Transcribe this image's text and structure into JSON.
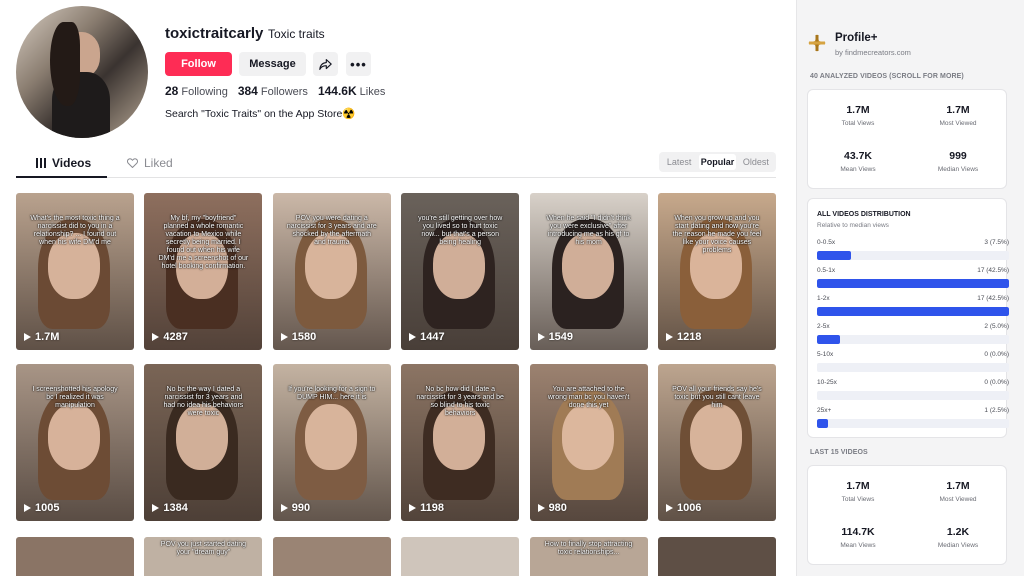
{
  "profile": {
    "username": "toxictraitcarly",
    "nickname": "Toxic traits",
    "follow_label": "Follow",
    "message_label": "Message",
    "following_count": "28",
    "following_label": "Following",
    "followers_count": "384",
    "followers_label": "Followers",
    "likes_count": "144.6K",
    "likes_label": "Likes",
    "bio": "Search \"Toxic Traits\" on the App Store☢️"
  },
  "tabs": {
    "videos": "Videos",
    "liked": "Liked"
  },
  "sort": {
    "latest": "Latest",
    "popular": "Popular",
    "oldest": "Oldest",
    "active": "Popular"
  },
  "videos": [
    {
      "views": "1.7M",
      "caption": "What's the most toxic thing a narcissist did to you in a relationship? ... I found out when his wife DM'd me",
      "bg": "#b9a28e",
      "hair": "#6b4a34"
    },
    {
      "views": "4287",
      "caption": "My bf, my \"boyfriend\" planned a whole romantic vacation to Mexico while secretly being married. I found out when his wife DM'd me a screenshot of our hotel booking confirmation.",
      "bg": "#8e6f5e",
      "hair": "#4a2f22"
    },
    {
      "views": "1580",
      "caption": "POV you were dating a narcissist for 3 years and are shocked by the aftermath and trauma",
      "bg": "#cbb8a8",
      "hair": "#7d5a3e"
    },
    {
      "views": "1447",
      "caption": "you're still getting over how you lived so to hurt toxic now... but that's a person being healing",
      "bg": "#6a625b",
      "hair": "#2e2320"
    },
    {
      "views": "1549",
      "caption": "When he said \"I didn't think you were exclusive\" after introducing me as his gf to his mom",
      "bg": "#d8d1c9",
      "hair": "#2b2220"
    },
    {
      "views": "1218",
      "caption": "When you grow up and you start dating and now you're the reason he made you feel like your voice causes problems",
      "bg": "#c7a98c",
      "hair": "#8a5f3a"
    },
    {
      "views": "1005",
      "caption": "I screenshotted his apology bc I realized it was manipulation",
      "bg": "#a89586",
      "hair": "#6d4c35"
    },
    {
      "views": "1384",
      "caption": "No bc the way I dated a narcissist for 3 years and had no idea his behaviors were toxic",
      "bg": "#7a6556",
      "hair": "#3a2a20"
    },
    {
      "views": "990",
      "caption": "If you're looking for a sign to DUMP HIM... here it is",
      "bg": "#c4b3a2",
      "hair": "#7e5c43"
    },
    {
      "views": "1198",
      "caption": "No bc how did I date a narcissist for 3 years and be so blind to his toxic behaviors",
      "bg": "#8c7564",
      "hair": "#3e2c22"
    },
    {
      "views": "980",
      "caption": "You are attached to the wrong man bc you haven't done this yet",
      "bg": "#9c8270",
      "hair": "#a07b55"
    },
    {
      "views": "1006",
      "caption": "POV all your friends say he's toxic but you still cant leave him",
      "bg": "#bda58f",
      "hair": "#6f4f36"
    }
  ],
  "videos_partial": [
    {
      "caption": "",
      "bg": "#8a7465"
    },
    {
      "caption": "POV you just started dating your \"dream guy\"",
      "bg": "#bfb1a3"
    },
    {
      "caption": "",
      "bg": "#9a8474"
    },
    {
      "caption": "",
      "bg": "#cfc5bb"
    },
    {
      "caption": "How to finally stop attracting toxic relationships...",
      "bg": "#b8a696"
    },
    {
      "caption": "",
      "bg": "#5e4f45"
    }
  ],
  "extension": {
    "title": "Profile+",
    "subtitle": "by findmecreators.com",
    "analyzed_label": "40 ANALYZED VIDEOS (SCROLL FOR MORE)",
    "analyzed_metrics": [
      {
        "value": "1.7M",
        "label": "Total Views"
      },
      {
        "value": "1.7M",
        "label": "Most Viewed"
      },
      {
        "value": "43.7K",
        "label": "Mean Views"
      },
      {
        "value": "999",
        "label": "Median Views"
      }
    ],
    "distribution": {
      "title": "ALL VIDEOS DISTRIBUTION",
      "subtitle": "Relative to median views",
      "buckets": [
        {
          "range": "0-0.5x",
          "count": "3 (7.5%)",
          "fraction": 0.176
        },
        {
          "range": "0.5-1x",
          "count": "17 (42.5%)",
          "fraction": 1.0
        },
        {
          "range": "1-2x",
          "count": "17 (42.5%)",
          "fraction": 1.0
        },
        {
          "range": "2-5x",
          "count": "2 (5.0%)",
          "fraction": 0.118
        },
        {
          "range": "5-10x",
          "count": "0 (0.0%)",
          "fraction": 0.0
        },
        {
          "range": "10-25x",
          "count": "0 (0.0%)",
          "fraction": 0.0
        },
        {
          "range": "25x+",
          "count": "1 (2.5%)",
          "fraction": 0.059
        }
      ]
    },
    "last_label": "LAST 15 VIDEOS",
    "last_metrics": [
      {
        "value": "1.7M",
        "label": "Total Views"
      },
      {
        "value": "1.7M",
        "label": "Most Viewed"
      },
      {
        "value": "114.7K",
        "label": "Mean Views"
      },
      {
        "value": "1.2K",
        "label": "Median Views"
      }
    ],
    "accent_color": "#2f54eb"
  },
  "colors": {
    "follow": "#fe2c55"
  }
}
